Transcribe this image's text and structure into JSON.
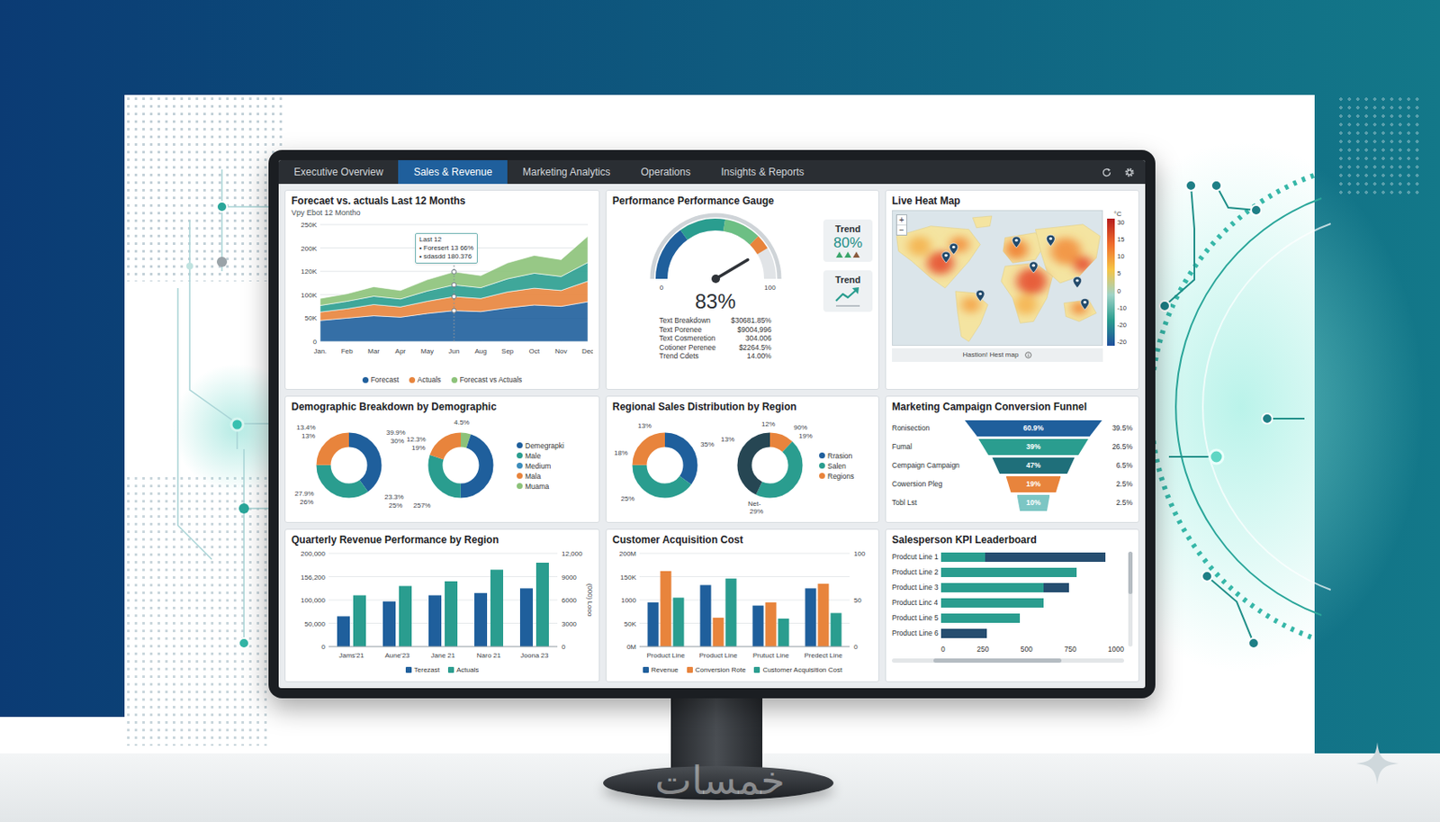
{
  "tabs": [
    {
      "label": "Executive Overview",
      "selected": false
    },
    {
      "label": "Sales & Revenue",
      "selected": true
    },
    {
      "label": "Marketing Analytics",
      "selected": false
    },
    {
      "label": "Operations",
      "selected": false
    },
    {
      "label": "Insights & Reports",
      "selected": false
    }
  ],
  "forecast": {
    "title": "Forecaet vs. actuals Last 12 Months",
    "subtitle": "Vpy Ebot 12 Montho",
    "y_ticks": [
      "250K",
      "200K",
      "120K",
      "100K",
      "50K",
      "0"
    ],
    "y_max": 250,
    "x_labels": [
      "Jan.",
      "Feb",
      "Mar",
      "Apr",
      "May",
      "Jun",
      "Aug",
      "Sep",
      "Oct",
      "Nov",
      "Dec"
    ],
    "series": [
      {
        "values": [
          45,
          50,
          55,
          52,
          60,
          66,
          64,
          72,
          78,
          75,
          85
        ],
        "color": "#1f5f9c"
      },
      {
        "values": [
          18,
          20,
          24,
          22,
          26,
          30,
          28,
          34,
          36,
          34,
          44
        ],
        "color": "#e8843c"
      },
      {
        "values": [
          14,
          16,
          18,
          17,
          22,
          25,
          23,
          28,
          32,
          30,
          40
        ],
        "color": "#2a9d8f"
      },
      {
        "values": [
          15,
          16,
          20,
          18,
          24,
          28,
          26,
          34,
          38,
          36,
          56
        ],
        "color": "#8cc279"
      }
    ],
    "tooltip": [
      "Last 12",
      "• Foresert 13 66%",
      "• sdasdd 180.376"
    ],
    "legend": [
      {
        "label": "Forecast",
        "color": "#1f5f9c"
      },
      {
        "label": "Actuals",
        "color": "#e8843c"
      },
      {
        "label": "Forecast vs Actuals",
        "color": "#8cc279"
      }
    ]
  },
  "gauge": {
    "title": "Performance Performance Gauge",
    "min": "0",
    "max": "100",
    "value": "83%",
    "level": 0.83,
    "rows": [
      {
        "label": "Text Breakdown",
        "value": "$30681.85%"
      },
      {
        "label": "Text Porenee",
        "value": "$9004,996"
      },
      {
        "label": "Text Cosmeretion",
        "value": "304.006"
      },
      {
        "label": "Cotioner Perenee",
        "value": "$2264.5%"
      },
      {
        "label": "Trend Cdets",
        "value": "14.00%"
      }
    ],
    "trends": [
      {
        "label": "Trend",
        "value": "80%",
        "kind": "value"
      },
      {
        "label": "Trend",
        "kind": "icon"
      }
    ]
  },
  "heatmap": {
    "title": "Live Heat Map",
    "zoom": [
      "+",
      "−"
    ],
    "unit": "°C",
    "ticks": [
      "30",
      "15",
      "10",
      "5",
      "0",
      "-10",
      "-20",
      "-20"
    ],
    "caption": "Hastion! Hest map"
  },
  "demographics": {
    "title": "Demographic Breakdown by Demographic",
    "donuts": [
      {
        "segments": [
          {
            "value": 40,
            "color": "#1f5f9c"
          },
          {
            "value": 35,
            "color": "#2a9d8f"
          },
          {
            "value": 25,
            "color": "#e8843c"
          }
        ],
        "labels": [
          "13.4%",
          "13%",
          "39.9%",
          "30%",
          "27.9%",
          "26%",
          "23.3%",
          "25%"
        ]
      },
      {
        "segments": [
          {
            "value": 5,
            "color": "#8cc279"
          },
          {
            "value": 45,
            "color": "#1f5f9c"
          },
          {
            "value": 30,
            "color": "#2a9d8f"
          },
          {
            "value": 20,
            "color": "#e8843c"
          }
        ],
        "labels": [
          "4.5%",
          "12.3%",
          "19%",
          "257%"
        ]
      }
    ],
    "legend": [
      {
        "label": "Demegrapki",
        "color": "#1f5f9c"
      },
      {
        "label": "Male",
        "color": "#2a9d8f"
      },
      {
        "label": "Medium",
        "color": "#3c8dbc"
      },
      {
        "label": "Mala",
        "color": "#e8843c"
      },
      {
        "label": "Muama",
        "color": "#8cc279"
      }
    ]
  },
  "regional": {
    "title": "Regional Sales Distribution by Region",
    "donuts": [
      {
        "segments": [
          {
            "value": 35,
            "color": "#1f5f9c"
          },
          {
            "value": 40,
            "color": "#2a9d8f"
          },
          {
            "value": 25,
            "color": "#e8843c"
          }
        ],
        "labels": [
          "13%",
          "35%",
          "18%",
          "25%"
        ]
      },
      {
        "segments": [
          {
            "value": 12,
            "color": "#e8843c"
          },
          {
            "value": 45,
            "color": "#2a9d8f"
          },
          {
            "value": 43,
            "color": "#264653"
          }
        ],
        "labels": [
          "12%",
          "13%",
          "90%",
          "19%",
          "Net-",
          "29%"
        ]
      }
    ],
    "legend": [
      {
        "label": "Rrasion",
        "color": "#1f5f9c"
      },
      {
        "label": "Salen",
        "color": "#2a9d8f"
      },
      {
        "label": "Regions",
        "color": "#e8843c"
      }
    ]
  },
  "funnel": {
    "title": "Marketing Campaign Conversion Funnel",
    "stages": [
      {
        "label": "Ronisection",
        "value": "60.9%",
        "rate": "39.5%",
        "level": 1,
        "color": "#1f5f9c"
      },
      {
        "label": "Fumal",
        "value": "39%",
        "rate": "26.5%",
        "level": 0.8,
        "color": "#2a9d8f"
      },
      {
        "label": "Cempaign Campaign",
        "value": "47%",
        "rate": "6.5%",
        "level": 0.6,
        "color": "#1f6f7a"
      },
      {
        "label": "Cowersion Pleg",
        "value": "19%",
        "rate": "2.5%",
        "level": 0.4,
        "color": "#e8843c"
      },
      {
        "label": "Tobl Lst",
        "value": "10%",
        "rate": "2.5%",
        "level": 0.24,
        "color": "#7cc6c4"
      }
    ]
  },
  "quarterly": {
    "title": "Quarterly Revenue Performance by Region",
    "y_ticks": [
      "200,000",
      "156,200",
      "100,000",
      "50,000",
      "0"
    ],
    "y_max": 200000,
    "y2_ticks": [
      "12,000",
      "9000",
      "6000",
      "3000",
      "0"
    ],
    "y2_label": "(000) Looo",
    "x_labels": [
      "Jams'21",
      "Aune'23",
      "Jane 21",
      "Naro 21",
      "Joona 23"
    ],
    "series": [
      {
        "label": "Terezast",
        "color": "#1f5f9c",
        "values": [
          65000,
          97000,
          110000,
          115000,
          125000
        ]
      },
      {
        "label": "Actuals",
        "color": "#2a9d8f",
        "values": [
          110000,
          130000,
          140000,
          165000,
          180000
        ]
      }
    ]
  },
  "cac": {
    "title": "Customer Acquisition Cost",
    "y_ticks": [
      "200M",
      "150K",
      "1000",
      "50K",
      "0M"
    ],
    "y_max": 200,
    "y2_ticks": [
      "100",
      "50",
      "0"
    ],
    "x_labels": [
      "Product Line",
      "Product Line",
      "Prutuct Line",
      "Predect Line"
    ],
    "series": [
      {
        "label": "Revenue",
        "color": "#1f5f9c",
        "values": [
          95,
          132,
          88,
          125
        ]
      },
      {
        "label": "Conversion Rote",
        "color": "#e8843c",
        "values": [
          162,
          62,
          95,
          135
        ]
      },
      {
        "label": "Customer Acquisition Cost",
        "color": "#2a9d8f",
        "values": [
          105,
          146,
          60,
          72
        ]
      }
    ]
  },
  "leaderboard": {
    "title": "Salesperson KPI Leaderboard",
    "x_ticks": [
      "0",
      "250",
      "500",
      "750",
      "1000"
    ],
    "x_max": 1000,
    "rows": [
      {
        "label": "Prodcut Line 1",
        "segments": [
          {
            "value": 240,
            "color": "#2a9d8f"
          },
          {
            "value": 660,
            "color": "#264e70"
          }
        ]
      },
      {
        "label": "Product Line 2",
        "segments": [
          {
            "value": 740,
            "color": "#2a9d8f"
          }
        ]
      },
      {
        "label": "Product Line 3",
        "segments": [
          {
            "value": 560,
            "color": "#2a9d8f"
          },
          {
            "value": 140,
            "color": "#264e70"
          }
        ]
      },
      {
        "label": "Product Linc 4",
        "segments": [
          {
            "value": 560,
            "color": "#2a9d8f"
          }
        ]
      },
      {
        "label": "Product Line 5",
        "segments": [
          {
            "value": 430,
            "color": "#2a9d8f"
          }
        ]
      },
      {
        "label": "Product Line 6",
        "segments": [
          {
            "value": 250,
            "color": "#264e70"
          }
        ]
      }
    ]
  },
  "watermark": "خمسات"
}
